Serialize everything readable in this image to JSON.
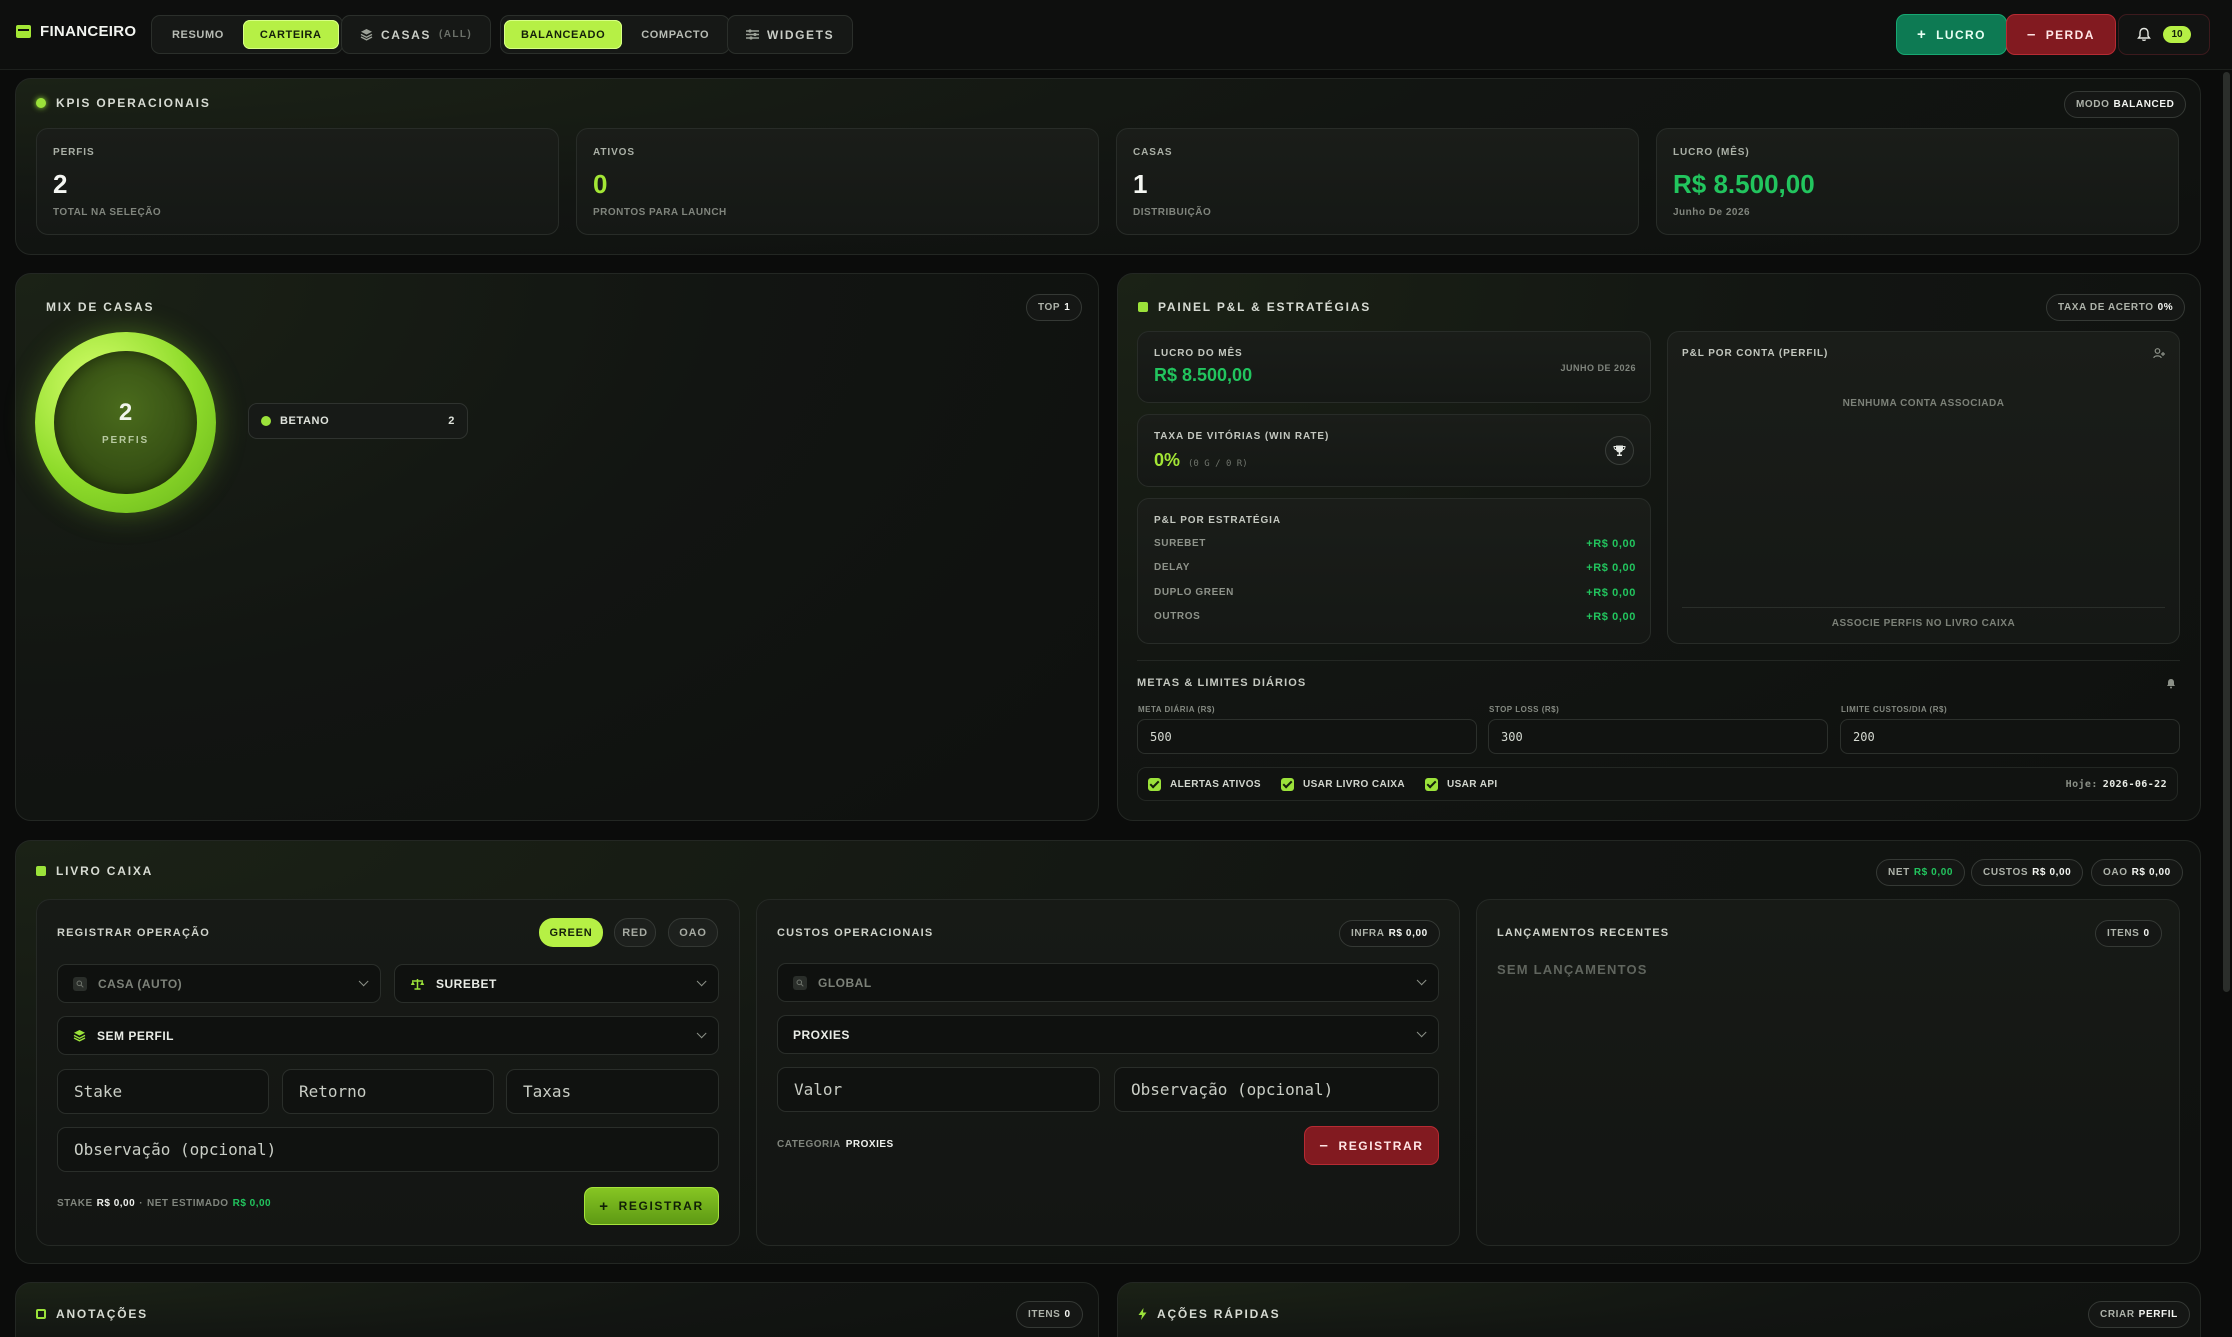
{
  "topbar": {
    "brand": "FINANCEIRO",
    "view_tabs": [
      "RESUMO",
      "CARTEIRA"
    ],
    "view_active": "CARTEIRA",
    "casas_label": "CASAS",
    "casas_filter": "(ALL)",
    "density_tabs": [
      "BALANCEADO",
      "COMPACTO"
    ],
    "density_active": "BALANCEADO",
    "widgets_label": "WIDGETS",
    "lucro_label": "LUCRO",
    "perda_label": "PERDA",
    "notif_count": "10"
  },
  "kpis": {
    "title": "KPIS OPERACIONAIS",
    "mode_label": "MODO",
    "mode_value": "BALANCED",
    "cards": [
      {
        "label": "PERFIS",
        "value": "2",
        "sub": "TOTAL NA SELEÇÃO"
      },
      {
        "label": "ATIVOS",
        "value": "0",
        "sub": "PRONTOS PARA LAUNCH"
      },
      {
        "label": "CASAS",
        "value": "1",
        "sub": "DISTRIBUIÇÃO"
      },
      {
        "label": "LUCRO (MÊS)",
        "value": "R$ 8.500,00",
        "sub": "Junho De 2026"
      }
    ]
  },
  "mix": {
    "title": "MIX DE CASAS",
    "top_label": "TOP",
    "top_value": "1",
    "donut_value": "2",
    "donut_label": "PERFIS",
    "items": [
      {
        "name": "BETANO",
        "count": "2"
      }
    ]
  },
  "pnl": {
    "title": "PAINEL P&L & ESTRATÉGIAS",
    "hit_rate_label": "TAXA DE ACERTO",
    "hit_rate_value": "0%",
    "month_profit_label": "LUCRO DO MÊS",
    "month_profit_value": "R$ 8.500,00",
    "month_profit_period": "JUNHO DE 2026",
    "win_rate_label": "TAXA DE VITÓRIAS (WIN RATE)",
    "win_rate_value": "0%",
    "win_rate_detail": "(0 G / 0 R)",
    "by_strategy_label": "P&L POR ESTRATÉGIA",
    "strategies": [
      {
        "name": "SUREBET",
        "value": "+R$ 0,00"
      },
      {
        "name": "DELAY",
        "value": "+R$ 0,00"
      },
      {
        "name": "DUPLO GREEN",
        "value": "+R$ 0,00"
      },
      {
        "name": "OUTROS",
        "value": "+R$ 0,00"
      }
    ],
    "by_account_label": "P&L POR CONTA (PERFIL)",
    "by_account_empty": "NENHUMA CONTA ASSOCIADA",
    "by_account_hint": "ASSOCIE PERFIS NO LIVRO CAIXA",
    "goals_title": "METAS & LIMITES DIÁRIOS",
    "goals": [
      {
        "label": "META DIÁRIA (R$)",
        "value": "500"
      },
      {
        "label": "STOP LOSS (R$)",
        "value": "300"
      },
      {
        "label": "LIMITE CUSTOS/DIA (R$)",
        "value": "200"
      }
    ],
    "checks": [
      "ALERTAS ATIVOS",
      "USAR LIVRO CAIXA",
      "USAR API"
    ],
    "today_label": "Hoje:",
    "today_value": "2026-06-22"
  },
  "livro": {
    "title": "LIVRO CAIXA",
    "net_label": "NET",
    "net_value": "R$ 0,00",
    "custos_label": "CUSTOS",
    "custos_value": "R$ 0,00",
    "oao_label": "OAO",
    "oao_value": "R$ 0,00",
    "register": {
      "title": "REGISTRAR OPERAÇÃO",
      "toggles": [
        "GREEN",
        "RED",
        "OAO"
      ],
      "toggle_active": "GREEN",
      "casa_placeholder": "CASA (AUTO)",
      "strategy": "SUREBET",
      "profile": "SEM PERFIL",
      "stake_placeholder": "Stake",
      "retorno_placeholder": "Retorno",
      "taxas_placeholder": "Taxas",
      "obs_placeholder": "Observação (opcional)",
      "summary_stake_label": "STAKE",
      "summary_stake_value": "R$ 0,00",
      "summary_sep": "·",
      "summary_net_label": "NET ESTIMADO",
      "summary_net_value": "R$ 0,00",
      "button": "REGISTRAR"
    },
    "costs": {
      "title": "CUSTOS OPERACIONAIS",
      "infra_label": "INFRA",
      "infra_value": "R$ 0,00",
      "scope": "GLOBAL",
      "category_select": "PROXIES",
      "valor_placeholder": "Valor",
      "obs_placeholder": "Observação (opcional)",
      "category_label": "CATEGORIA",
      "category_value": "PROXIES",
      "button": "REGISTRAR"
    },
    "recent": {
      "title": "LANÇAMENTOS RECENTES",
      "items_label": "ITENS",
      "items_value": "0",
      "empty": "SEM LANÇAMENTOS"
    }
  },
  "notes": {
    "title": "ANOTAÇÕES",
    "items_label": "ITENS",
    "items_value": "0"
  },
  "quick": {
    "title": "AÇÕES RÁPIDAS",
    "create_label": "CRIAR",
    "create_value": "PERFIL"
  },
  "colors": {
    "accent": "#b6f045",
    "profit": "#22c55e",
    "loss": "#821a20",
    "positive_btn": "#0d7a53"
  }
}
